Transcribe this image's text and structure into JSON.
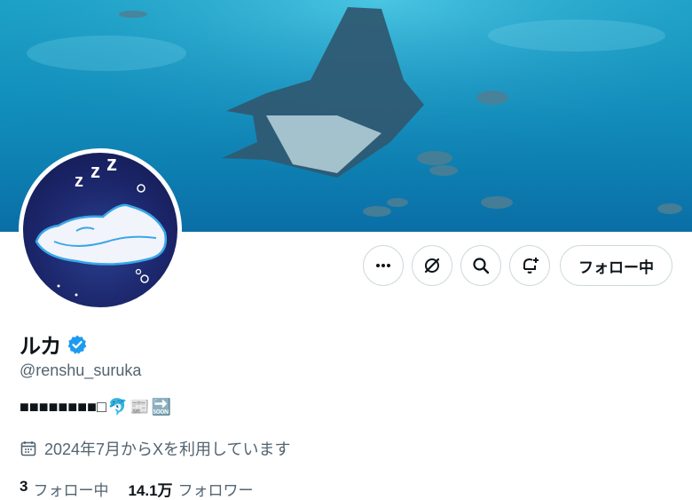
{
  "profile": {
    "display_name": "ルカ",
    "handle": "@renshu_suruka",
    "bio_text": "■■■■■■■■□",
    "bio_emoji_1": "🐬",
    "bio_emoji_2": "📰",
    "bio_emoji_3": "🔜",
    "joined": "2024年7月からXを利用しています",
    "verified": true
  },
  "stats": {
    "following_count": "3",
    "following_label": "フォロー中",
    "followers_count": "14.1万",
    "followers_label": "フォロワー"
  },
  "actions": {
    "more_icon": "more-icon",
    "grok_icon": "grok-icon",
    "search_icon": "search-icon",
    "notify_icon": "notification-bell-icon",
    "follow_label": "フォロー中"
  },
  "colors": {
    "verified_blue": "#1d9bf0",
    "secondary_text": "#536471",
    "border": "#cfd9de"
  }
}
